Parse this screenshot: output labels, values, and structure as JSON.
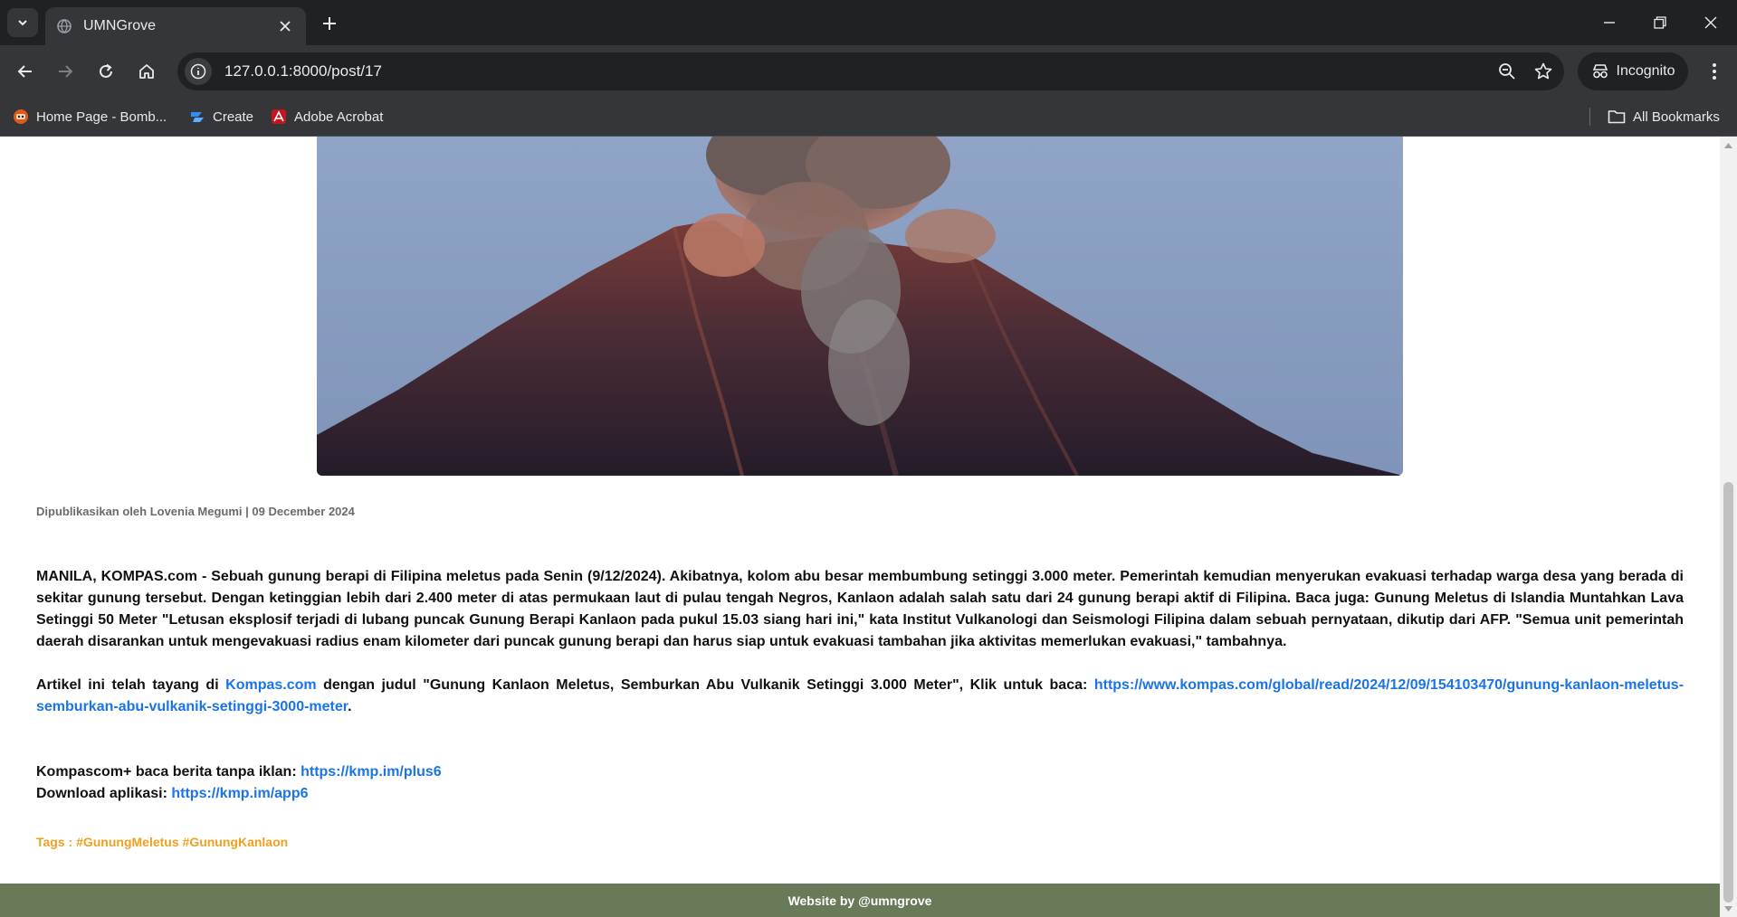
{
  "browser": {
    "tab": {
      "title": "UMNGrove"
    },
    "url": "127.0.0.1:8000/post/17",
    "incognito_label": "Incognito",
    "bookmarks": [
      {
        "label": "Home Page - Bomb..."
      },
      {
        "label": "Create"
      },
      {
        "label": "Adobe Acrobat"
      }
    ],
    "all_bookmarks_label": "All Bookmarks"
  },
  "post": {
    "hero_image": "volcano-eruption-photo",
    "meta": "Dipublikasikan oleh Lovenia Megumi | 09 December 2024",
    "paragraph1": "MANILA, KOMPAS.com - Sebuah gunung berapi di Filipina meletus pada Senin (9/12/2024). Akibatnya, kolom abu besar membumbung setinggi 3.000 meter. Pemerintah kemudian menyerukan evakuasi terhadap warga desa yang berada di sekitar gunung tersebut. Dengan ketinggian lebih dari 2.400 meter di atas permukaan laut di pulau tengah Negros, Kanlaon adalah salah satu dari 24 gunung berapi aktif di Filipina. Baca juga: Gunung Meletus di Islandia Muntahkan Lava Setinggi 50 Meter \"Letusan eksplosif terjadi di lubang puncak Gunung Berapi Kanlaon pada pukul 15.03 siang hari ini,\" kata Institut Vulkanologi dan Seismologi Filipina dalam sebuah pernyataan, dikutip dari AFP. \"Semua unit pemerintah daerah disarankan untuk mengevakuasi radius enam kilometer dari puncak gunung berapi dan harus siap untuk evakuasi tambahan jika aktivitas memerlukan evakuasi,\" tambahnya.",
    "p2_prefix": "Artikel ini telah tayang di ",
    "p2_link1": "Kompas.com",
    "p2_middle": " dengan judul \"Gunung Kanlaon Meletus, Semburkan Abu Vulkanik Setinggi 3.000 Meter\", Klik untuk baca: ",
    "p2_link2": "https://www.kompas.com/global/read/2024/12/09/154103470/gunung-kanlaon-meletus-semburkan-abu-vulkanik-setinggi-3000-meter",
    "p2_suffix": ".",
    "plus_label": "Kompascom+ baca berita tanpa iklan: ",
    "plus_link": "https://kmp.im/plus6",
    "app_label": "Download aplikasi: ",
    "app_link": "https://kmp.im/app6",
    "tags": "Tags : #GunungMeletus #GunungKanlaon"
  },
  "footer": {
    "text": "Website by @umngrove"
  },
  "colors": {
    "link": "#1a73e8",
    "tags": "#f0a020",
    "footer_bg": "#687a58"
  }
}
